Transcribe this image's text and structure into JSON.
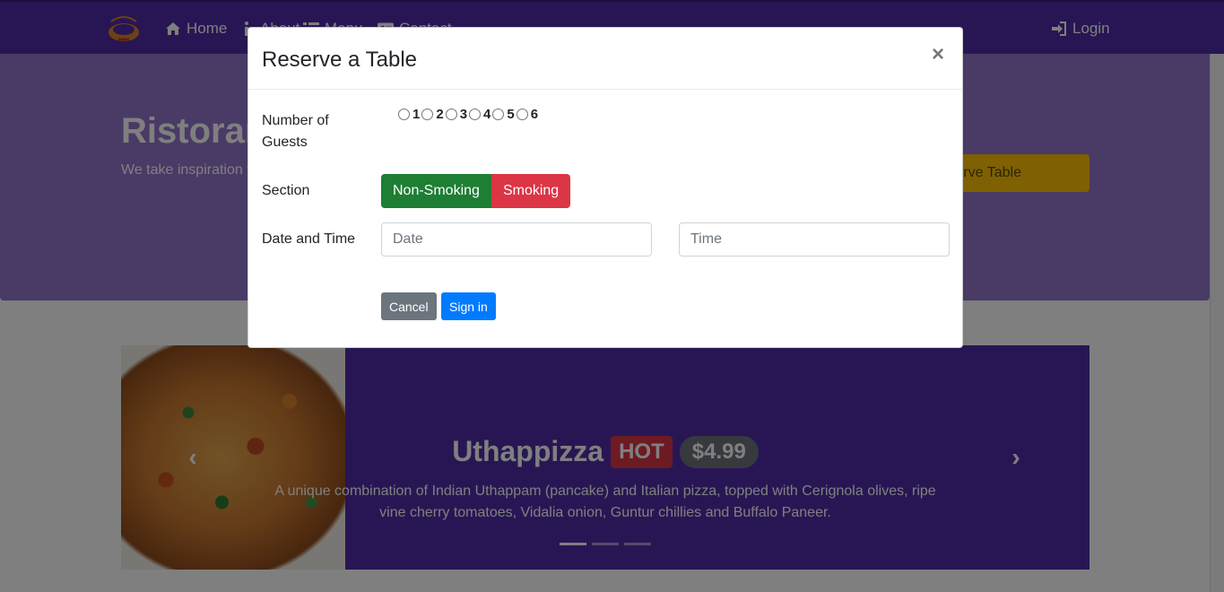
{
  "navbar": {
    "brand_icon": "restaurant-logo",
    "items": [
      {
        "label": "Home",
        "icon": "home-icon"
      },
      {
        "label": "About",
        "icon": "info-icon"
      },
      {
        "label": "Menu",
        "icon": "list-icon"
      },
      {
        "label": "Contact",
        "icon": "address-card-icon"
      }
    ],
    "login_label": "Login",
    "login_icon": "sign-in-icon",
    "color": "#512da8"
  },
  "jumbotron": {
    "title": "Ristoran",
    "text": "We take inspiration fusion experience. O senses!",
    "reserve_label": "rve Table",
    "color": "#9575cd",
    "button_color": "#ffc107"
  },
  "carousel": {
    "title": "Uthappizza",
    "badge_hot": "HOT",
    "price": "$4.99",
    "description": "A unique combination of Indian Uthappam (pancake) and Italian pizza, topped with Cerignola olives, ripe vine cherry tomatoes, Vidalia onion, Guntur chillies and Buffalo Paneer.",
    "indicators": 3,
    "active_indicator": 0
  },
  "modal": {
    "title": "Reserve a Table",
    "close_label": "×",
    "guests_label": "Number of Guests",
    "guest_options": [
      "1",
      "2",
      "3",
      "4",
      "5",
      "6"
    ],
    "section_label": "Section",
    "section_options": [
      "Non-Smoking",
      "Smoking"
    ],
    "datetime_label": "Date and Time",
    "date_placeholder": "Date",
    "time_placeholder": "Time",
    "cancel_label": "Cancel",
    "submit_label": "Sign in",
    "colors": {
      "non_smoking": "#1e7e34",
      "smoking": "#dc3545",
      "cancel": "#6c757d",
      "submit": "#007bff"
    }
  }
}
